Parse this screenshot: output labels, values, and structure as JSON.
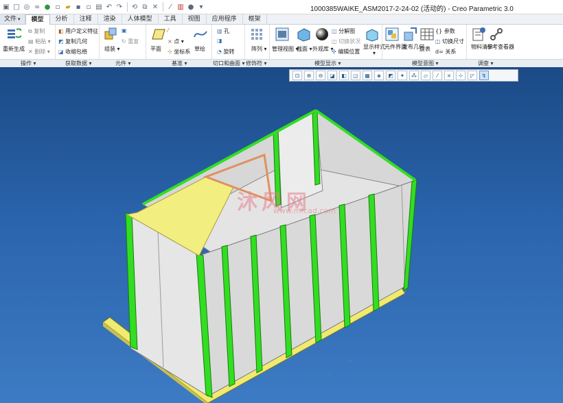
{
  "window": {
    "title": "1000385WAIKE_ASM2017-2-24-02 (活动的) - Creo Parametric 3.0"
  },
  "tabs": [
    {
      "label": "文件",
      "active": false
    },
    {
      "label": "模型",
      "active": true
    },
    {
      "label": "分析",
      "active": false
    },
    {
      "label": "注释",
      "active": false
    },
    {
      "label": "渲染",
      "active": false
    },
    {
      "label": "人体模型",
      "active": false
    },
    {
      "label": "工具",
      "active": false
    },
    {
      "label": "视图",
      "active": false
    },
    {
      "label": "应用程序",
      "active": false
    },
    {
      "label": "框架",
      "active": false
    }
  ],
  "ribbon": {
    "regenerate": "重新生成",
    "copy": "复制",
    "paste": "粘贴",
    "delete": "删除",
    "udf": "用户定义特征",
    "copy_geom": "复制几何",
    "shrinkwrap": "收缩包络",
    "assemble": "组装",
    "repeat": "重复",
    "plane": "平面",
    "point": "点",
    "csys": "坐标系",
    "sketch": "草绘",
    "hole": "孔",
    "revolve": "旋转",
    "pattern": "阵列",
    "manage_views": "管理视图",
    "section": "截面",
    "appearance": "外观库",
    "explode": "分解图",
    "toggle_state": "切换状况",
    "edit_position": "编辑位置",
    "display_style": "显示样式",
    "component_interface": "元件界面",
    "publish_geom": "发布几何",
    "table": "旋表",
    "params": "参数",
    "toggle_dims": "切换尺寸",
    "relations": "关系",
    "bom": "物料清单",
    "ref_viewer": "参考查看器"
  },
  "groups": [
    "操作",
    "获取数据",
    "元件",
    "基准",
    "切口和曲面",
    "修饰符",
    "模型显示",
    "模型意图",
    "调查"
  ],
  "watermark": {
    "text": "沐风网",
    "url": "www.mfcad.com"
  },
  "colors": {
    "viewport_top": "#1b4a86",
    "viewport_bottom": "#3d7bc4",
    "panel_white": "#e6e6e6",
    "frame_green": "#33dd22",
    "highlight_yellow": "#f2ee80"
  }
}
